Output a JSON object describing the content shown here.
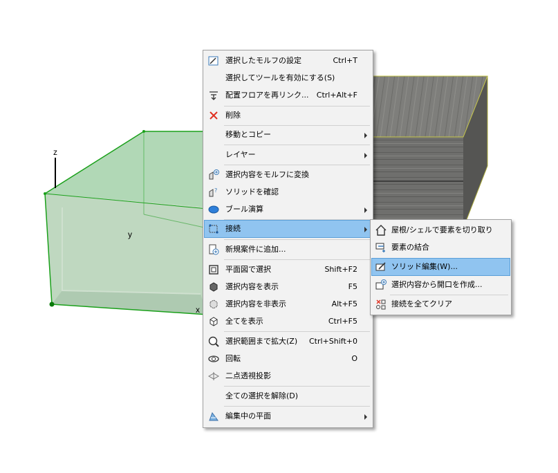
{
  "axes": {
    "z": "z",
    "y": "y",
    "x": "x"
  },
  "context_menu": {
    "items": [
      {
        "label": "選択したモルフの設定",
        "shortcut": "Ctrl+T",
        "icon": "morph-settings-icon"
      },
      {
        "label": "選択してツールを有効にする(S)",
        "shortcut": "",
        "icon": ""
      },
      {
        "label": "配置フロアを再リンク...",
        "shortcut": "Ctrl+Alt+F",
        "icon": "relink-floor-icon"
      },
      {
        "label": "削除",
        "shortcut": "",
        "icon": "delete-icon"
      },
      {
        "label": "移動とコピー",
        "shortcut": "",
        "icon": ""
      },
      {
        "label": "レイヤー",
        "shortcut": "",
        "icon": ""
      },
      {
        "label": "選択内容をモルフに変換",
        "shortcut": "",
        "icon": "convert-to-morph-icon"
      },
      {
        "label": "ソリッドを確認",
        "shortcut": "",
        "icon": "check-solid-icon"
      },
      {
        "label": "ブール演算",
        "shortcut": "",
        "icon": "boolean-icon"
      },
      {
        "label": "接続",
        "shortcut": "",
        "icon": "connect-icon"
      },
      {
        "label": "新規案件に追加...",
        "shortcut": "",
        "icon": "add-issue-icon"
      },
      {
        "label": "平面図で選択",
        "shortcut": "Shift+F2",
        "icon": "select-in-plan-icon"
      },
      {
        "label": "選択内容を表示",
        "shortcut": "F5",
        "icon": "show-selection-icon"
      },
      {
        "label": "選択内容を非表示",
        "shortcut": "Alt+F5",
        "icon": "hide-selection-icon"
      },
      {
        "label": "全てを表示",
        "shortcut": "Ctrl+F5",
        "icon": "show-all-icon"
      },
      {
        "label": "選択範囲まで拡大(Z)",
        "shortcut": "Ctrl+Shift+0",
        "icon": "zoom-selection-icon"
      },
      {
        "label": "回転",
        "shortcut": "O",
        "icon": "orbit-icon"
      },
      {
        "label": "二点透視投影",
        "shortcut": "",
        "icon": "two-point-perspective-icon"
      },
      {
        "label": "全ての選択を解除(D)",
        "shortcut": "",
        "icon": ""
      },
      {
        "label": "編集中の平面",
        "shortcut": "",
        "icon": "editing-plane-icon"
      }
    ]
  },
  "submenu": {
    "items": [
      {
        "label": "屋根/シェルで要素を切り取り",
        "icon": "trim-roof-icon"
      },
      {
        "label": "要素の結合",
        "icon": "merge-elements-icon"
      },
      {
        "label": "ソリッド編集(W)...",
        "icon": "solid-edit-icon"
      },
      {
        "label": "選択内容から開口を作成...",
        "icon": "create-opening-icon"
      },
      {
        "label": "接続を全てクリア",
        "icon": "clear-connections-icon"
      }
    ]
  },
  "colors": {
    "highlight": "#90c4f0",
    "selection_green": "#1aa01a",
    "menu_bg": "#f2f2f2"
  }
}
